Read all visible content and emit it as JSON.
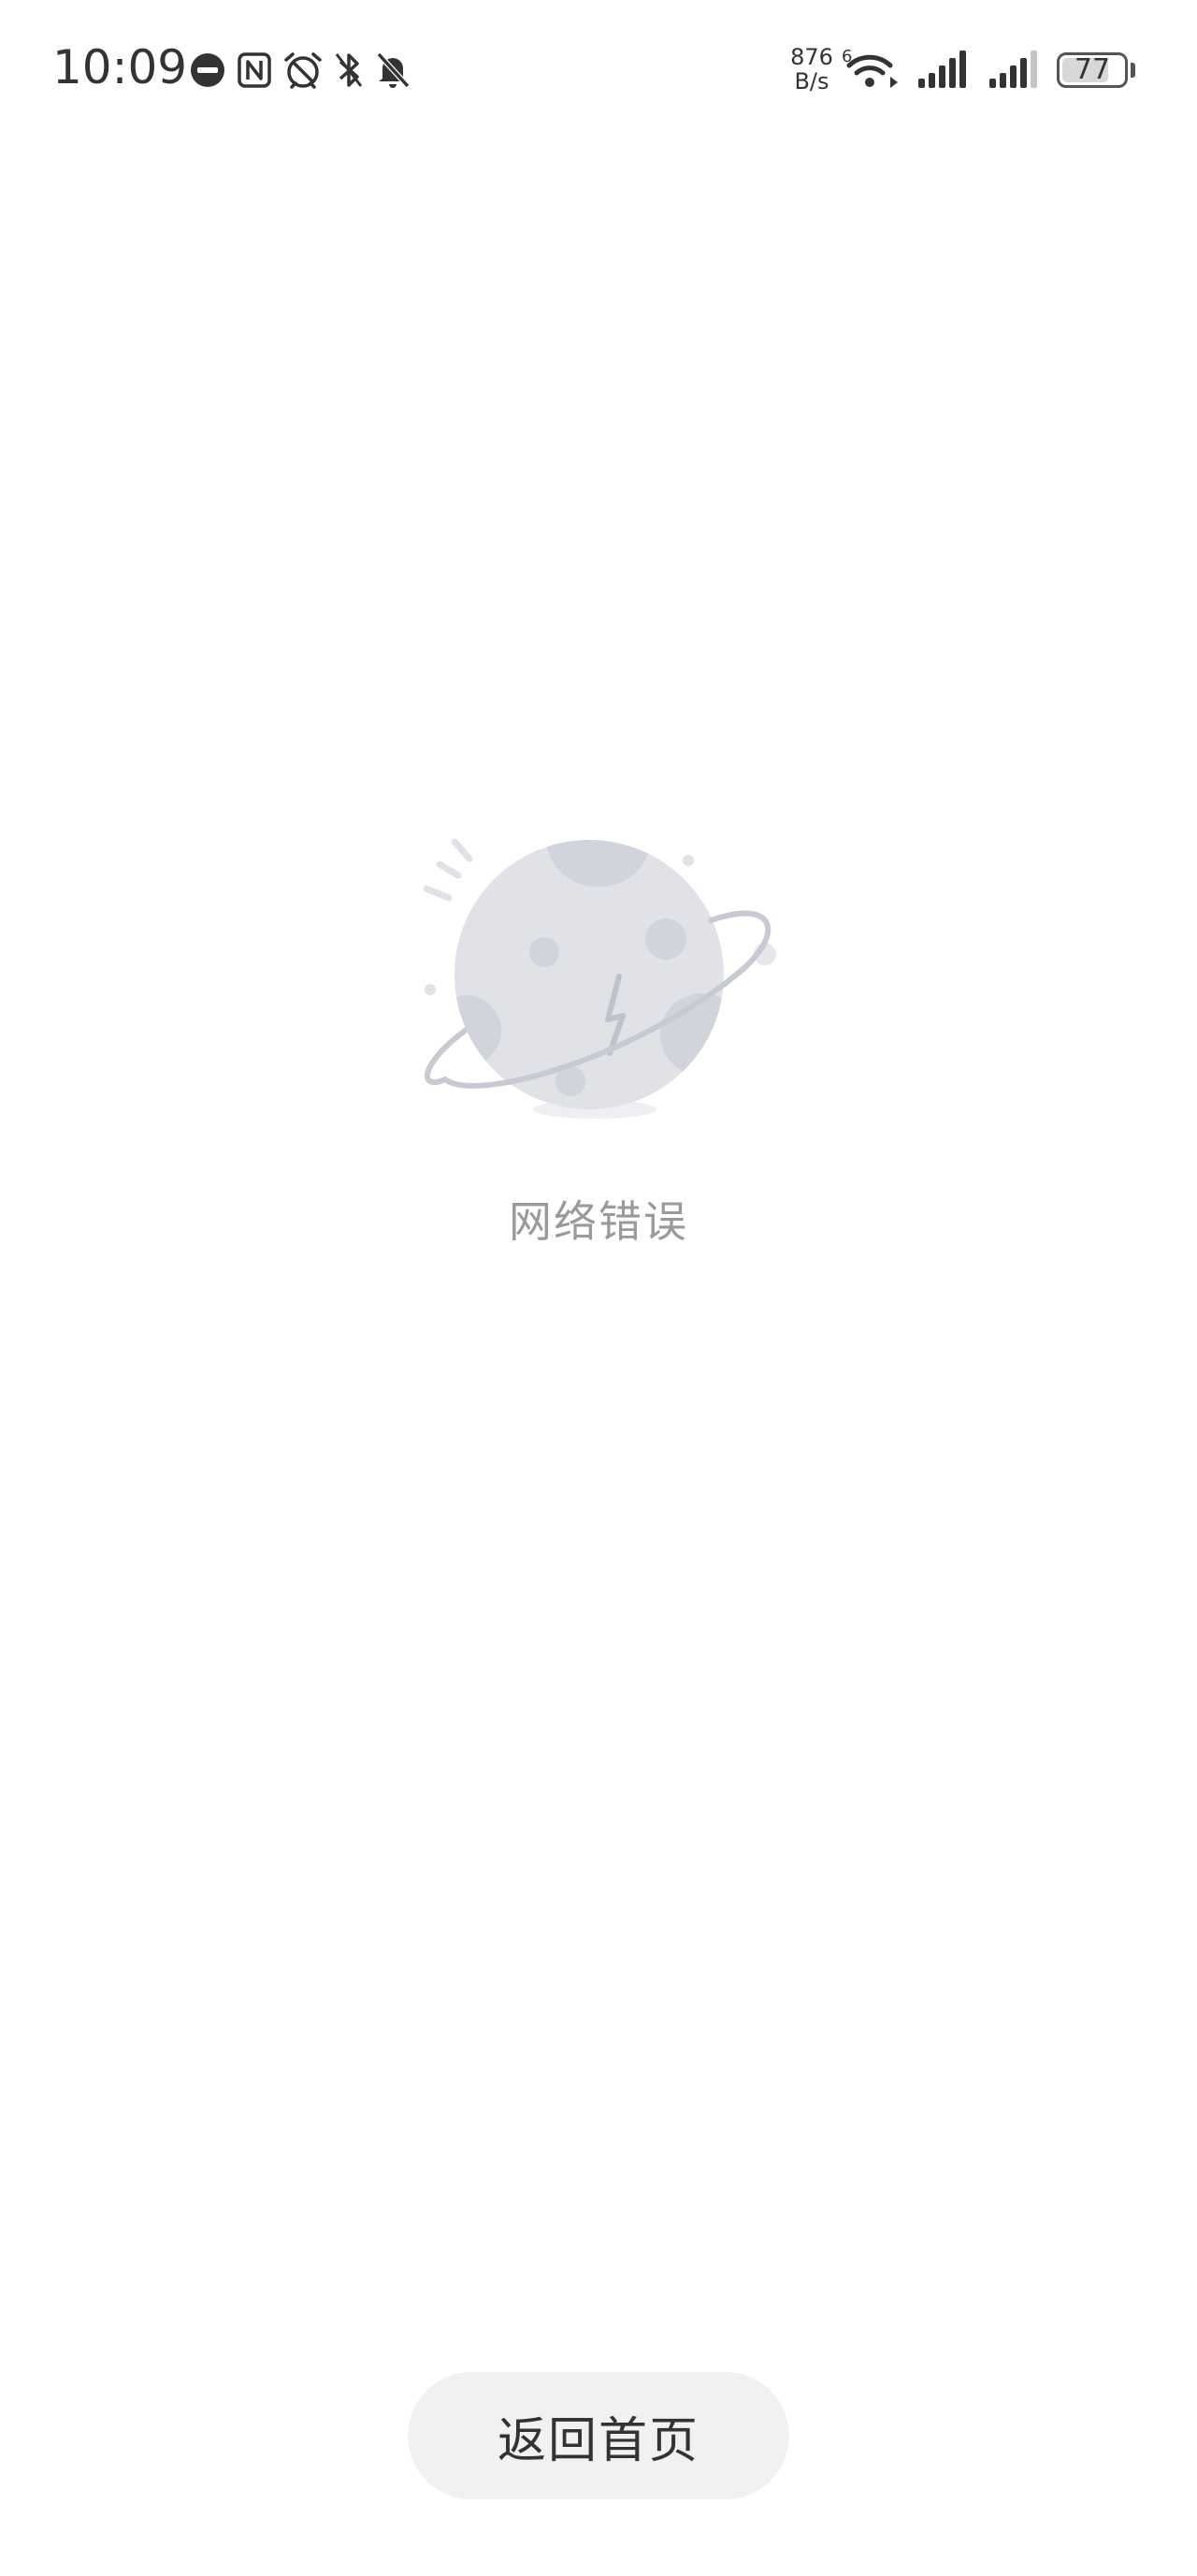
{
  "status_bar": {
    "time": "10:09",
    "net_speed_value": "876",
    "net_speed_unit": "B/s",
    "wifi_badge": "6",
    "battery_level": "77",
    "battery_fraction": 0.77,
    "left_icons": [
      "app-badge-icon",
      "nfc-icon",
      "alarm-icon",
      "bluetooth-icon",
      "mute-icon"
    ],
    "right_icons": [
      "wifi-icon",
      "signal-icon",
      "signal-icon"
    ]
  },
  "main": {
    "illustration": "network-error-planet-icon",
    "error_message": "网络错误",
    "home_button_label": "返回首页"
  },
  "colors": {
    "background": "#ffffff",
    "planet": "#e1e2e7",
    "planet_crater": "#d2d4dc",
    "error_text": "#9a9a9a",
    "button_bg": "#f1f1f1",
    "button_text": "#333333"
  }
}
